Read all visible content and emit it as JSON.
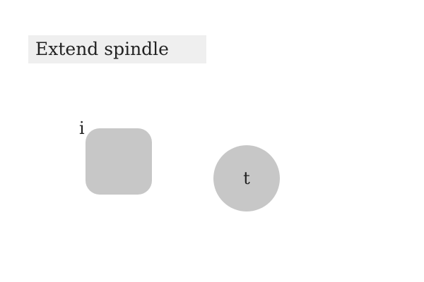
{
  "instruction": {
    "text": "Extend spindle"
  },
  "shapes": {
    "square_label": "i",
    "circle_label": "t"
  },
  "colors": {
    "shape_fill": "#c7c7c7",
    "label_background": "#efefef",
    "text": "#222222"
  }
}
